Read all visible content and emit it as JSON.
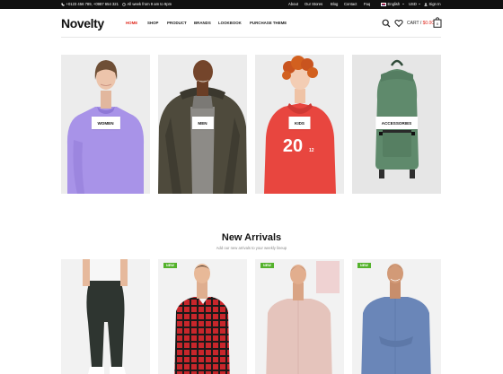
{
  "topbar": {
    "phones": "+0123 456 789, +0987 654 321",
    "hours": "All week from 9 am to 9pm",
    "links": [
      "About",
      "Our Stores",
      "Blog",
      "Contact",
      "Faq"
    ],
    "language": "English",
    "currency": "USD",
    "signin": "Sign In"
  },
  "header": {
    "logo": "Novelty",
    "nav": [
      "HOME",
      "SHOP",
      "PRODUCT",
      "BRANDS",
      "LOOKBOOK",
      "PURCHASE THEME"
    ],
    "active_nav": "HOME",
    "cart_label": "CART /",
    "cart_total": "$0.00",
    "cart_count": "0"
  },
  "categories": [
    "WOMEN",
    "MEN",
    "KIDS",
    "ACCESSORIES"
  ],
  "new_arrivals": {
    "title": "New Arrivals",
    "subtitle": "Add our new arrivals to your weekly lineup",
    "products": [
      {
        "badge": ""
      },
      {
        "badge": "NEW"
      },
      {
        "badge": "NEW"
      },
      {
        "badge": "NEW"
      }
    ]
  },
  "colors": {
    "accent": "#e02b20",
    "badge": "#54b22c",
    "topbar": "#111111"
  }
}
